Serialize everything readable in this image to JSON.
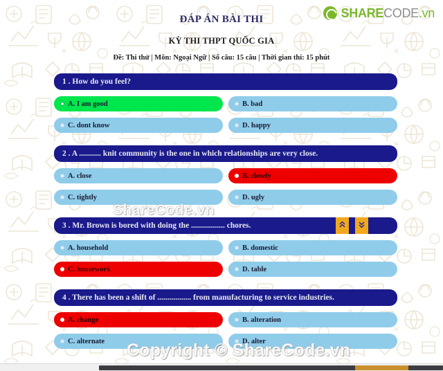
{
  "logo": {
    "part1": "SHARE",
    "part2": "CODE",
    "part3": ".vn",
    "mark": "recycle-icon",
    "color_primary": "#79B72B",
    "color_secondary": "#8D8D8D"
  },
  "header": {
    "title": "ĐÁP ÁN BÀI THI",
    "subtitle": "KỲ THI THPT QUỐC GIA",
    "meta": "Đề: Thi thử | Môn: Ngoại Ngữ | Số câu: 15 câu | Thời gian thi: 15 phút"
  },
  "watermarks": {
    "middle": "ShareCode.vn",
    "bottom": "Copyright © ShareCode.vn"
  },
  "tools": {
    "scroll_up_label": "scroll-up",
    "scroll_down_label": "scroll-down",
    "color": "#F0A81E"
  },
  "colors": {
    "question_bar": "#1A1A8C",
    "option_default": "#8FCCEA",
    "option_correct": "#00E64D",
    "option_wrong": "#EE0000"
  },
  "questions": [
    {
      "number": "1",
      "text": "How do you feel?",
      "has_tools": false,
      "options": [
        {
          "label": "A. I am good",
          "state": "correct"
        },
        {
          "label": "B. bad",
          "state": "default"
        },
        {
          "label": "C. dont know",
          "state": "default"
        },
        {
          "label": "D. happy",
          "state": "default"
        }
      ]
    },
    {
      "number": "2",
      "text": "A ........... knit community is the one in which relationships are very close.",
      "has_tools": false,
      "options": [
        {
          "label": "A. close",
          "state": "default"
        },
        {
          "label": "B. closely",
          "state": "wrong"
        },
        {
          "label": "C. tightly",
          "state": "default"
        },
        {
          "label": "D. ugly",
          "state": "default"
        }
      ]
    },
    {
      "number": "3",
      "text": "Mr. Brown is bored with doing the ................. chores.",
      "has_tools": true,
      "options": [
        {
          "label": "A. household",
          "state": "default"
        },
        {
          "label": "B. domestic",
          "state": "default"
        },
        {
          "label": "C. housework",
          "state": "wrong"
        },
        {
          "label": "D. table",
          "state": "default"
        }
      ]
    },
    {
      "number": "4",
      "text": "There has been a shift of ................. from manufacturing to service industries.",
      "has_tools": false,
      "options": [
        {
          "label": "A. change",
          "state": "wrong"
        },
        {
          "label": "B. alteration",
          "state": "default"
        },
        {
          "label": "C. alternate",
          "state": "default"
        },
        {
          "label": "D. alter",
          "state": "default"
        }
      ]
    }
  ]
}
